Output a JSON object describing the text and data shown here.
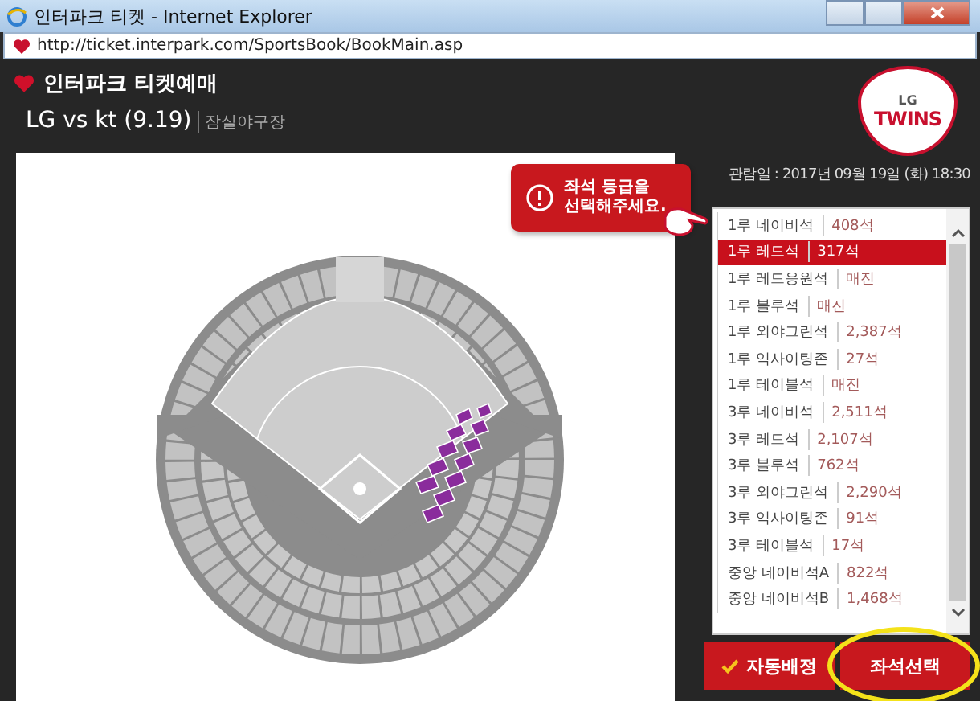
{
  "window": {
    "title": "인터파크 티켓 - Internet Explorer",
    "url": "http://ticket.interpark.com/SportsBook/BookMain.asp"
  },
  "header": {
    "brand": "인터파크 티켓예매",
    "match": "LG vs kt (9.19)",
    "venue": "잠실야구장",
    "date": "관람일 : 2017년 09월 19일 (화) 18:30",
    "team_logo": {
      "top": "LG",
      "main": "TWINS"
    }
  },
  "tooltip": {
    "text": "좌석 등급을\n선택해주세요."
  },
  "seat_grades": [
    {
      "name": "1루 네이비석",
      "count": "408석",
      "selected": false
    },
    {
      "name": "1루 레드석",
      "count": "317석",
      "selected": true
    },
    {
      "name": "1루 레드응원석",
      "count": "매진",
      "selected": false
    },
    {
      "name": "1루 블루석",
      "count": "매진",
      "selected": false
    },
    {
      "name": "1루 외야그린석",
      "count": "2,387석",
      "selected": false
    },
    {
      "name": "1루 익사이팅존",
      "count": "27석",
      "selected": false
    },
    {
      "name": "1루 테이블석",
      "count": "매진",
      "selected": false
    },
    {
      "name": "3루 네이비석",
      "count": "2,511석",
      "selected": false
    },
    {
      "name": "3루 레드석",
      "count": "2,107석",
      "selected": false
    },
    {
      "name": "3루 블루석",
      "count": "762석",
      "selected": false
    },
    {
      "name": "3루 외야그린석",
      "count": "2,290석",
      "selected": false
    },
    {
      "name": "3루 익사이팅존",
      "count": "91석",
      "selected": false
    },
    {
      "name": "3루 테이블석",
      "count": "17석",
      "selected": false
    },
    {
      "name": "중앙 네이비석A",
      "count": "822석",
      "selected": false
    },
    {
      "name": "중앙 네이비석B",
      "count": "1,468석",
      "selected": false
    }
  ],
  "buttons": [
    {
      "label": "자동배정",
      "kind": "auto"
    },
    {
      "label": "좌석선택",
      "kind": "select",
      "highlighted": true
    }
  ]
}
